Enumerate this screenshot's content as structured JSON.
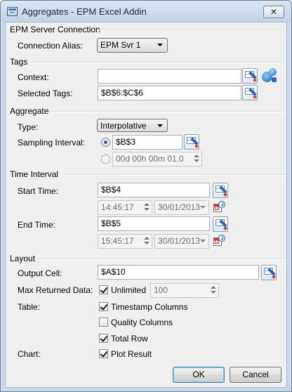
{
  "window": {
    "title": "Aggregates - EPM Excel Addin",
    "close_label": "✕"
  },
  "server_connection": {
    "heading": "EPM Server Connection",
    "alias_label": "Connection Alias:",
    "alias_value": "EPM Svr 1"
  },
  "tags": {
    "heading": "Tags",
    "context_label": "Context:",
    "context_value": "",
    "selected_label": "Selected Tags:",
    "selected_value": "$B$6:$C$6"
  },
  "aggregate": {
    "heading": "Aggregate",
    "type_label": "Type:",
    "type_value": "Interpolative",
    "sampling_label": "Sampling Interval:",
    "sampling_ref_value": "$B$3",
    "sampling_duration_value": "00d 00h 00m 01.0",
    "sampling_mode": "reference"
  },
  "time_interval": {
    "heading": "Time Interval",
    "start_label": "Start Time:",
    "start_ref_value": "$B$4",
    "start_time_value": "14:45:17",
    "start_date_value": "30/01/2013",
    "end_label": "End Time:",
    "end_ref_value": "$B$5",
    "end_time_value": "15:45:17",
    "end_date_value": "30/01/2013",
    "calendar_number": "12"
  },
  "layout": {
    "heading": "Layout",
    "output_label": "Output Cell:",
    "output_value": "$A$10",
    "max_label": "Max Returned Data:",
    "unlimited_label": "Unlimited",
    "unlimited_checked": true,
    "max_value": "100",
    "table_label": "Table:",
    "timestamp_label": "Timestamp Columns",
    "timestamp_checked": true,
    "quality_label": "Quality Columns",
    "quality_checked": false,
    "total_label": "Total Row",
    "total_checked": true,
    "chart_label": "Chart:",
    "plot_label": "Plot Result",
    "plot_checked": true
  },
  "buttons": {
    "ok_label": "OK",
    "cancel_label": "Cancel"
  }
}
